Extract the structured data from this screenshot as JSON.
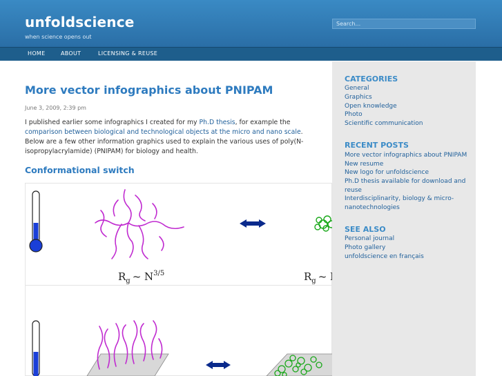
{
  "header": {
    "site_title": "unfoldscience",
    "tagline": "when science opens out",
    "search_placeholder": "Search..."
  },
  "nav": {
    "items": [
      "HOME",
      "ABOUT",
      "LICENSING & REUSE"
    ]
  },
  "post": {
    "title": "More vector infographics about PNIPAM",
    "date": "June 3, 2009, 2:39 pm",
    "body": {
      "t1": "I published earlier some infographics I created for my ",
      "link1": "Ph.D thesis",
      "t2": ", for example the ",
      "link2": "comparison between biological and technological objects at the micro and nano scale",
      "t3": ". Below are a few other information graphics used to explain the various uses of poly(N-isopropylacrylamide) (PNIPAM) for biology and health."
    },
    "section_heading": "Conformational switch"
  },
  "infographic": {
    "formula_left_prefix": "R",
    "formula_left_sub": "g",
    "formula_left_rel": "~ N",
    "formula_left_exp": "3/5",
    "formula_right_prefix": "R",
    "formula_right_sub": "g",
    "formula_right_rel": "~ N",
    "colors": {
      "polymer": "#c02ad0",
      "arrow": "#0a2a8c",
      "cold": "#1a3fd8",
      "hot": "#f04a10",
      "globule": "#1aa81a"
    }
  },
  "sidebar": {
    "categories_heading": "CATEGORIES",
    "categories": [
      "General",
      "Graphics",
      "Open knowledge",
      "Photo",
      "Scientific communication"
    ],
    "recent_heading": "RECENT POSTS",
    "recent": [
      "More vector infographics about PNIPAM",
      "New resume",
      "New logo for unfoldscience",
      "Ph.D thesis available for download and",
      "reuse",
      "Interdisciplinarity, biology & micro-",
      "nanotechnologies"
    ],
    "see_also_heading": "SEE ALSO",
    "see_also": [
      "Personal journal",
      "Photo gallery",
      "unfoldscience en français"
    ]
  }
}
